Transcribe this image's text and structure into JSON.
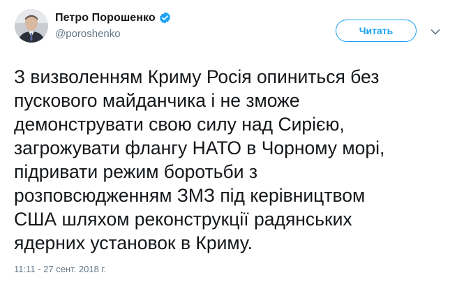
{
  "author": {
    "name": "Петро Порошенко",
    "handle": "@poroshenko",
    "verified_icon": "verified-badge-icon",
    "accent": "#1da1f2"
  },
  "follow_button": {
    "label": "Читать"
  },
  "menu": {
    "icon": "chevron-down-icon"
  },
  "tweet": {
    "lines": [
      "З визволенням Криму Росія опиниться без",
      "пускового майданчика і не зможе",
      "демонструвати свою силу над Сирією,",
      "загрожувати флангу НАТО в Чорному морі,",
      "підривати режим боротьби з",
      "розповсюдженням ЗМЗ під керівництвом",
      "США шляхом реконструкції радянських",
      "ядерних установок в Криму."
    ],
    "timestamp": "11:11 - 27 сент. 2018 г."
  }
}
